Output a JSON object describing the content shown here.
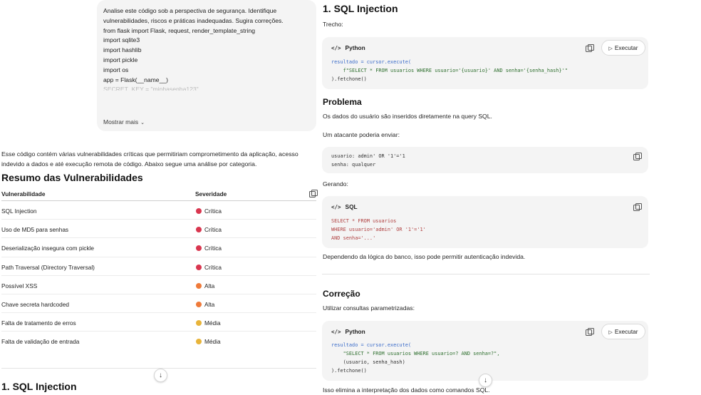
{
  "user_message": {
    "lines": [
      "Analise este código sob a perspectiva de segurança. Identifique",
      "vulnerabilidades, riscos e práticas inadequadas. Sugira correções.",
      "",
      "from flask import Flask, request, render_template_string",
      "import sqlite3",
      "import hashlib",
      "import pickle",
      "import os",
      "",
      "app = Flask(__name__)"
    ],
    "faded_line": "SECRET_KEY = \"minhasenha123\"",
    "show_more": "Mostrar mais"
  },
  "response": {
    "intro": "Esse código contém várias vulnerabilidades críticas que permitiriam comprometimento da aplicação, acesso indevido a dados e até execução remota de código. Abaixo segue uma análise por categoria.",
    "summary_title": "Resumo das Vulnerabilidades",
    "table": {
      "headers": [
        "Vulnerabilidade",
        "Severidade"
      ],
      "rows": [
        {
          "name": "SQL Injection",
          "severity": "Crítica",
          "color": "#d9364f"
        },
        {
          "name": "Uso de MD5 para senhas",
          "severity": "Crítica",
          "color": "#d9364f"
        },
        {
          "name": "Deserialização insegura com pickle",
          "severity": "Crítica",
          "color": "#d9364f"
        },
        {
          "name": "Path Traversal (Directory Traversal)",
          "severity": "Crítica",
          "color": "#d9364f"
        },
        {
          "name": "Possível XSS",
          "severity": "Alta",
          "color": "#ef7a3a"
        },
        {
          "name": "Chave secreta hardcoded",
          "severity": "Alta",
          "color": "#ef7a3a"
        },
        {
          "name": "Falta de tratamento de erros",
          "severity": "Média",
          "color": "#e8b43a"
        },
        {
          "name": "Falta de validação de entrada",
          "severity": "Média",
          "color": "#e8b43a"
        }
      ]
    },
    "section_left_title": "1. SQL Injection"
  },
  "right_panel": {
    "title": "1. SQL Injection",
    "trecho_label": "Trecho:",
    "code1": {
      "lang": "Python",
      "exec_label": "Executar",
      "lines": [
        "resultado = cursor.execute(",
        "    f\"SELECT * FROM usuarios WHERE usuario='{usuario}' AND senha='{senha_hash}'\"",
        ").fetchone()"
      ]
    },
    "problema_title": "Problema",
    "problema_text": "Os dados do usuário são inseridos diretamente na query SQL.",
    "atacante_text": "Um atacante poderia enviar:",
    "code2": {
      "lines": [
        "usuario: admin' OR '1'='1",
        "senha: qualquer"
      ]
    },
    "gerando_label": "Gerando:",
    "code3": {
      "lang": "SQL",
      "lines": [
        "SELECT * FROM usuarios",
        "WHERE usuario='admin' OR '1'='1'",
        "AND senha='...'"
      ]
    },
    "dependendo_text": "Dependendo da lógica do banco, isso pode permitir autenticação indevida.",
    "correcao_title": "Correção",
    "correcao_text": "Utilizar consultas parametrizadas:",
    "code4": {
      "lang": "Python",
      "exec_label": "Executar",
      "lines": [
        "resultado = cursor.execute(",
        "    \"SELECT * FROM usuarios WHERE usuario=? AND senha=?\",",
        "    (usuario, senha_hash)",
        ").fetchone()"
      ]
    },
    "elimina_text": "Isso elimina a interpretação dos dados como comandos SQL."
  }
}
